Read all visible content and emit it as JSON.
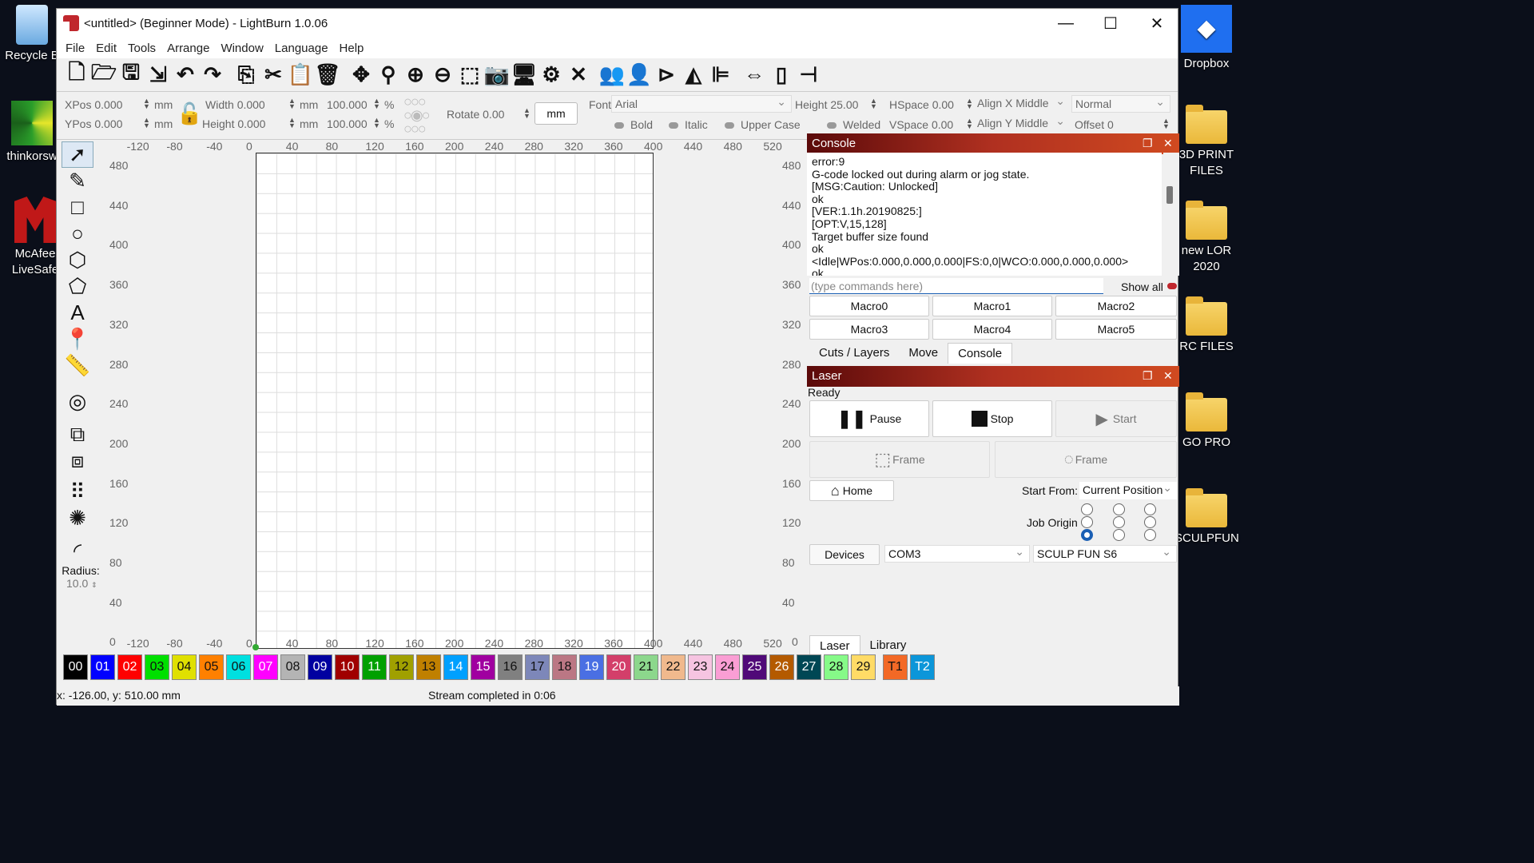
{
  "desktop": {
    "left_icons": [
      {
        "label": "Recycle B",
        "icon": "recycle-bin-icon"
      },
      {
        "label": "thinkorsw",
        "icon": "app-icon"
      },
      {
        "label": "McAfee LiveSafe",
        "icon": "mcafee-icon"
      }
    ],
    "right_icons": [
      {
        "label": "Dropbox",
        "icon": "dropbox-icon"
      },
      {
        "label": "3D PRINT FILES",
        "icon": "folder-icon"
      },
      {
        "label": "new LOR 2020",
        "icon": "folder-icon"
      },
      {
        "label": "RC FILES",
        "icon": "folder-icon"
      },
      {
        "label": "GO PRO",
        "icon": "folder-icon"
      },
      {
        "label": "SCULPFUN",
        "icon": "folder-icon"
      }
    ]
  },
  "window": {
    "title": "<untitled> (Beginner Mode) - LightBurn 1.0.06",
    "controls": {
      "minimize": "—",
      "maximize": "☐",
      "close": "✕"
    }
  },
  "menu": [
    "File",
    "Edit",
    "Tools",
    "Arrange",
    "Window",
    "Language",
    "Help"
  ],
  "props": {
    "xpos_label": "XPos",
    "xpos": "0.000",
    "ypos_label": "YPos",
    "ypos": "0.000",
    "unit": "mm",
    "width_label": "Width",
    "width": "0.000",
    "height_label": "Height",
    "height": "0.000",
    "scale_w": "100.000",
    "scale_h": "100.000",
    "percent": "%",
    "rotate_label": "Rotate",
    "rotate": "0.00",
    "units_button": "mm",
    "font_label": "Font",
    "font": "Arial",
    "font_height_label": "Height",
    "font_height": "25.00",
    "hspace_label": "HSpace",
    "hspace": "0.00",
    "vspace_label": "VSpace",
    "vspace": "0.00",
    "align_x": "Align X Middle",
    "align_y": "Align Y Middle",
    "normal": "Normal",
    "offset_label": "Offset",
    "offset": "0",
    "bold": "Bold",
    "italic": "Italic",
    "upper_case": "Upper Case",
    "welded": "Welded"
  },
  "left_tools": {
    "radius_label": "Radius:",
    "radius": "10.0"
  },
  "canvas": {
    "x_ticks": [
      "-120",
      "-80",
      "-40",
      "0",
      "40",
      "80",
      "120",
      "160",
      "200",
      "240",
      "280",
      "320",
      "360",
      "400",
      "440",
      "480",
      "520"
    ],
    "y_ticks": [
      "480",
      "440",
      "400",
      "360",
      "320",
      "280",
      "240",
      "200",
      "160",
      "120",
      "80",
      "40",
      "0"
    ]
  },
  "console": {
    "title": "Console",
    "lines": [
      "error:9",
      "G-code locked out during alarm or jog state.",
      "[MSG:Caution: Unlocked]",
      "ok",
      "[VER:1.1h.20190825:]",
      "[OPT:V,15,128]",
      "Target buffer size found",
      "ok",
      "<Idle|WPos:0.000,0.000,0.000|FS:0,0|WCO:0.000,0.000,0.000>",
      "ok"
    ],
    "command_placeholder": "(type commands here)",
    "show_all": "Show all",
    "macros": [
      "Macro0",
      "Macro1",
      "Macro2",
      "Macro3",
      "Macro4",
      "Macro5"
    ],
    "tabs": [
      "Cuts / Layers",
      "Move",
      "Console"
    ]
  },
  "laser": {
    "title": "Laser",
    "status": "Ready",
    "pause": "Pause",
    "stop": "Stop",
    "start": "Start",
    "frame1": "Frame",
    "frame2": "Frame",
    "home": "Home",
    "start_from_label": "Start From:",
    "start_from": "Current Position",
    "job_origin_label": "Job Origin",
    "devices": "Devices",
    "port": "COM3",
    "device": "SCULP FUN S6",
    "tabs": [
      "Laser",
      "Library"
    ]
  },
  "palette": [
    {
      "n": "00",
      "c": "#000000",
      "t": "#ffffff"
    },
    {
      "n": "01",
      "c": "#0000ff",
      "t": "#ffffff"
    },
    {
      "n": "02",
      "c": "#ff0000",
      "t": "#ffffff"
    },
    {
      "n": "03",
      "c": "#00e000",
      "t": "#111111"
    },
    {
      "n": "04",
      "c": "#e0e000",
      "t": "#111111"
    },
    {
      "n": "05",
      "c": "#ff8000",
      "t": "#111111"
    },
    {
      "n": "06",
      "c": "#00e0e0",
      "t": "#111111"
    },
    {
      "n": "07",
      "c": "#ff00ff",
      "t": "#ffffff"
    },
    {
      "n": "08",
      "c": "#b4b4b4",
      "t": "#111111"
    },
    {
      "n": "09",
      "c": "#0000a0",
      "t": "#ffffff"
    },
    {
      "n": "10",
      "c": "#a00000",
      "t": "#ffffff"
    },
    {
      "n": "11",
      "c": "#00a000",
      "t": "#ffffff"
    },
    {
      "n": "12",
      "c": "#a0a000",
      "t": "#111111"
    },
    {
      "n": "13",
      "c": "#c08000",
      "t": "#111111"
    },
    {
      "n": "14",
      "c": "#00a0ff",
      "t": "#ffffff"
    },
    {
      "n": "15",
      "c": "#a000a0",
      "t": "#ffffff"
    },
    {
      "n": "16",
      "c": "#808080",
      "t": "#111111"
    },
    {
      "n": "17",
      "c": "#7d87b9",
      "t": "#111111"
    },
    {
      "n": "18",
      "c": "#bb7784",
      "t": "#111111"
    },
    {
      "n": "19",
      "c": "#4a6fe3",
      "t": "#ffffff"
    },
    {
      "n": "20",
      "c": "#d33f6a",
      "t": "#ffffff"
    },
    {
      "n": "21",
      "c": "#8cd78c",
      "t": "#111111"
    },
    {
      "n": "22",
      "c": "#f0b98d",
      "t": "#111111"
    },
    {
      "n": "23",
      "c": "#f6c4e1",
      "t": "#111111"
    },
    {
      "n": "24",
      "c": "#fa9ed4",
      "t": "#111111"
    },
    {
      "n": "25",
      "c": "#500a78",
      "t": "#ffffff"
    },
    {
      "n": "26",
      "c": "#b45a00",
      "t": "#ffffff"
    },
    {
      "n": "27",
      "c": "#004754",
      "t": "#ffffff"
    },
    {
      "n": "28",
      "c": "#86fa88",
      "t": "#111111"
    },
    {
      "n": "29",
      "c": "#ffdb66",
      "t": "#111111"
    },
    {
      "n": "T1",
      "c": "#f36926",
      "t": "#111111"
    },
    {
      "n": "T2",
      "c": "#0c96d9",
      "t": "#ffffff"
    }
  ],
  "status": {
    "coords": "x: -126.00, y: 510.00 mm",
    "message": "Stream completed in 0:06"
  }
}
